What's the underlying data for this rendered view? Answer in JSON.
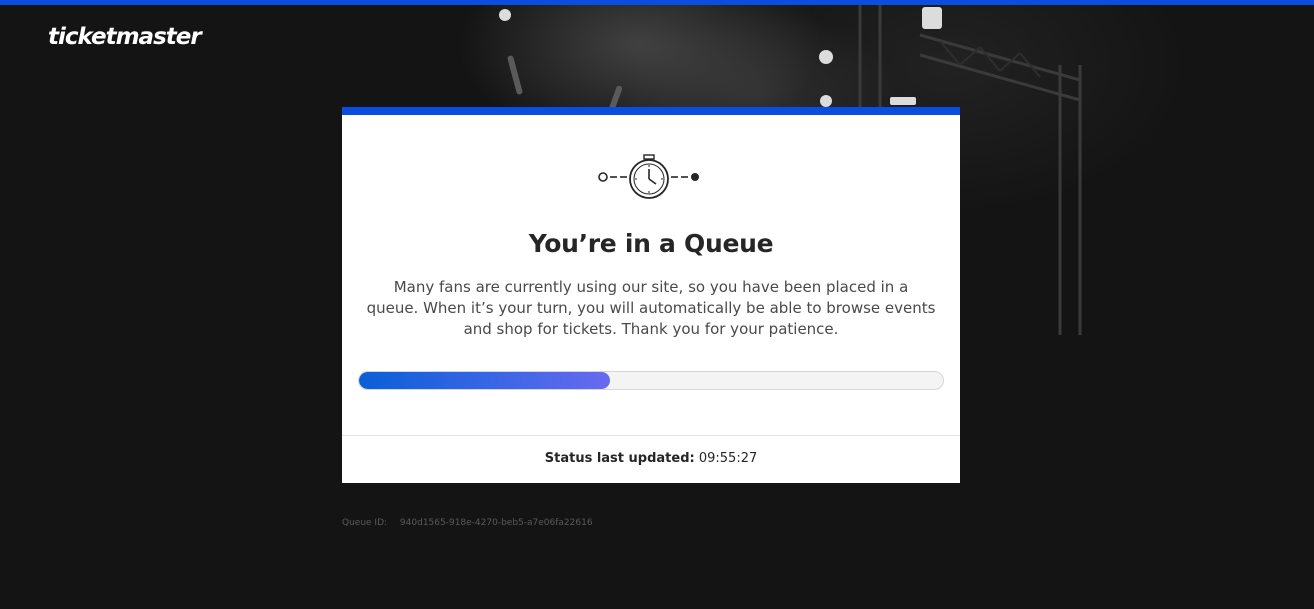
{
  "brand": {
    "logo_text": "ticketmaster",
    "accent_color": "#0a4de0"
  },
  "queue_card": {
    "icon": "stopwatch-icon",
    "title": "You’re in a Queue",
    "description": "Many fans are currently using our site, so you have been placed in a queue. When it’s your turn, you will automatically be able to browse events and shop for tickets. Thank you for your patience.",
    "progress_fraction": 0.43,
    "status_label": "Status last updated:",
    "status_time": "09:55:27"
  },
  "footer": {
    "queue_id_label": "Queue ID:",
    "queue_id_value": "940d1565-918e-4270-beb5-a7e06fa22616"
  }
}
